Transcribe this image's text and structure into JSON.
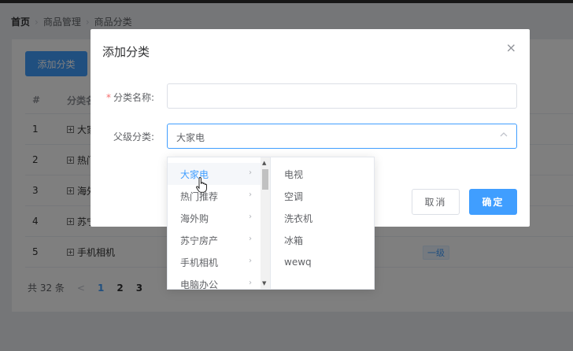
{
  "breadcrumb": {
    "home": "首页",
    "level2": "商品管理",
    "level3": "商品分类"
  },
  "toolbar": {
    "add_label": "添加分类"
  },
  "table": {
    "headers": [
      "#",
      "分类名称"
    ],
    "rows": [
      {
        "index": "1",
        "name": "大家电"
      },
      {
        "index": "2",
        "name": "热门推荐"
      },
      {
        "index": "3",
        "name": "海外购"
      },
      {
        "index": "4",
        "name": "苏宁房产"
      },
      {
        "index": "5",
        "name": "手机相机",
        "level": "一级"
      }
    ],
    "expand_symbol": "+"
  },
  "pagination": {
    "total": "共 32 条",
    "prev": "<",
    "pages": [
      "1",
      "2",
      "3"
    ],
    "current": "1"
  },
  "dialog": {
    "title": "添加分类",
    "close": "×",
    "name_label": "分类名称:",
    "required_mark": "*",
    "name_value": "",
    "parent_label": "父级分类:",
    "parent_value": "大家电",
    "cancel_label": "取消",
    "ok_label": "确定"
  },
  "cascader": {
    "level1": [
      "大家电",
      "热门推荐",
      "海外购",
      "苏宁房产",
      "手机相机",
      "电脑办公"
    ],
    "level1_selected": "大家电",
    "level2": [
      "电视",
      "空调",
      "洗衣机",
      "冰箱",
      "wewq"
    ]
  },
  "colors": {
    "primary": "#409eff",
    "required": "#f56c6c",
    "text": "#606266"
  }
}
